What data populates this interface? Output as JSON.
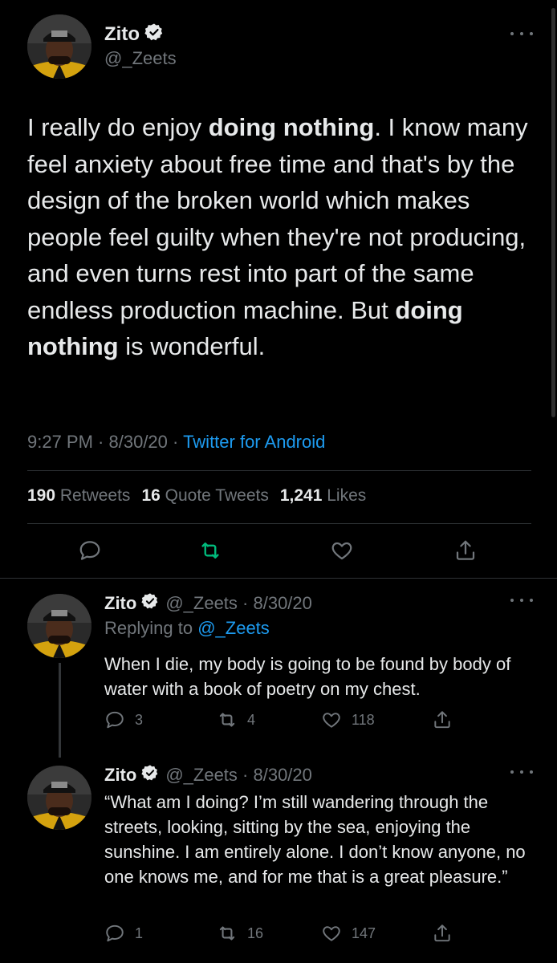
{
  "main_tweet": {
    "author_name": "Zito",
    "handle": "@_Zeets",
    "body": [
      {
        "text": "I really do enjoy ",
        "bold": false
      },
      {
        "text": "doing nothing",
        "bold": true
      },
      {
        "text": ". I know many feel anxiety about free time and that's by the design of the broken world which makes people feel guilty when they're not producing, and even turns rest into part of the same endless production machine. But ",
        "bold": false
      },
      {
        "text": "doing nothing",
        "bold": true
      },
      {
        "text": " is wonderful.",
        "bold": false
      }
    ],
    "time": "9:27 PM",
    "date": "8/30/20",
    "source": "Twitter for Android",
    "stats": {
      "retweets_count": "190",
      "retweets_label": "Retweets",
      "quotes_count": "16",
      "quotes_label": "Quote Tweets",
      "likes_count": "1,241",
      "likes_label": "Likes"
    }
  },
  "replies": [
    {
      "author_name": "Zito",
      "handle": "@_Zeets",
      "date": "8/30/20",
      "replying_prefix": "Replying to",
      "replying_to": "@_Zeets",
      "text": "When I die, my body is going to be found by body of water with a book of poetry on my chest.",
      "reply_count": "3",
      "retweet_count": "4",
      "like_count": "118"
    },
    {
      "author_name": "Zito",
      "handle": "@_Zeets",
      "date": "8/30/20",
      "text": "“What am I doing? I’m still wandering through the streets, looking, sitting by the sea, enjoying the sunshine. I am entirely alone. I don’t know anyone, no one knows me, and for me that is a great pleasure.”",
      "reply_count": "1",
      "retweet_count": "16",
      "like_count": "147"
    }
  ],
  "colors": {
    "background": "#000000",
    "text": "#e7e9ea",
    "muted": "#71767b",
    "link": "#1d9bf0",
    "retweet_green": "#00ba7c",
    "divider": "#2f3336"
  },
  "icons": {
    "verified": "verified-badge-icon",
    "more": "more-dots-icon",
    "reply": "reply-icon",
    "retweet": "retweet-icon",
    "like": "heart-icon",
    "share": "share-icon"
  }
}
